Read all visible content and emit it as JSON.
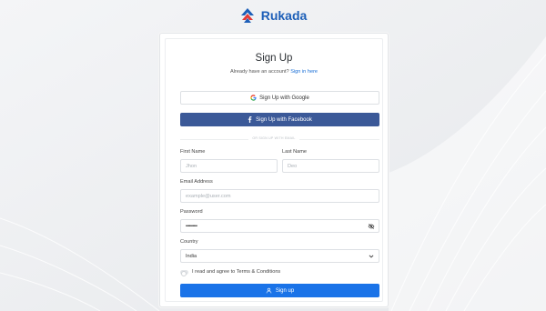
{
  "brand": {
    "name": "Rukada"
  },
  "signup": {
    "title": "Sign Up",
    "subtitle_prefix": "Already have an account?",
    "signin_link": "Sign in here",
    "google_label": "Sign Up with Google",
    "facebook_label": "Sign Up with Facebook",
    "divider_text": "OR SIGN UP WITH EMAIL",
    "first_name": {
      "label": "First Name",
      "placeholder": "Jhon"
    },
    "last_name": {
      "label": "Last Name",
      "placeholder": "Deo"
    },
    "email": {
      "label": "Email Address",
      "placeholder": "example@user.com"
    },
    "password": {
      "label": "Password",
      "value": "••••••••••"
    },
    "country": {
      "label": "Country",
      "selected": "India"
    },
    "agree_label": "I read and agree to Terms & Conditions",
    "submit_label": "Sign up"
  },
  "colors": {
    "primary": "#1a73e8",
    "facebook": "#3b5998",
    "brand": "#1d5fb8",
    "link": "#1a6fd6"
  },
  "icons": [
    "rukada-logo-icon",
    "google-icon",
    "facebook-icon",
    "eye-slash-icon",
    "chevron-down-icon",
    "user-icon"
  ]
}
